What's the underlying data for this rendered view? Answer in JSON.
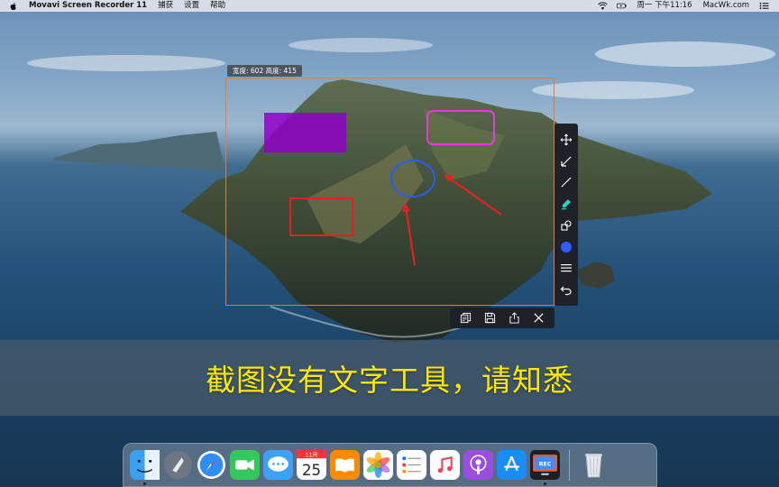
{
  "menubar": {
    "app_name": "Movavi Screen Recorder 11",
    "menus": [
      "捕获",
      "设置",
      "帮助"
    ],
    "clock": "周一 下午11:16",
    "site": "MacWk.com"
  },
  "capture": {
    "dimensions_label": "宽度: 602  高度: 415"
  },
  "toolbar": {
    "tools": [
      "move-icon",
      "arrow-icon",
      "line-icon",
      "marker-icon",
      "shapes-icon",
      "color-icon",
      "line-width-icon",
      "undo-icon"
    ],
    "active_color": "#2f5bff"
  },
  "actions": [
    "copy-icon",
    "save-icon",
    "share-icon",
    "close-icon"
  ],
  "banner": {
    "text": "截图没有文字工具，请知悉"
  },
  "dock": {
    "calendar_month": "11月",
    "calendar_day": "25",
    "rec_badge": "REC"
  },
  "colors": {
    "selection_border": "#e8793a",
    "banner_text": "#ffe800"
  }
}
